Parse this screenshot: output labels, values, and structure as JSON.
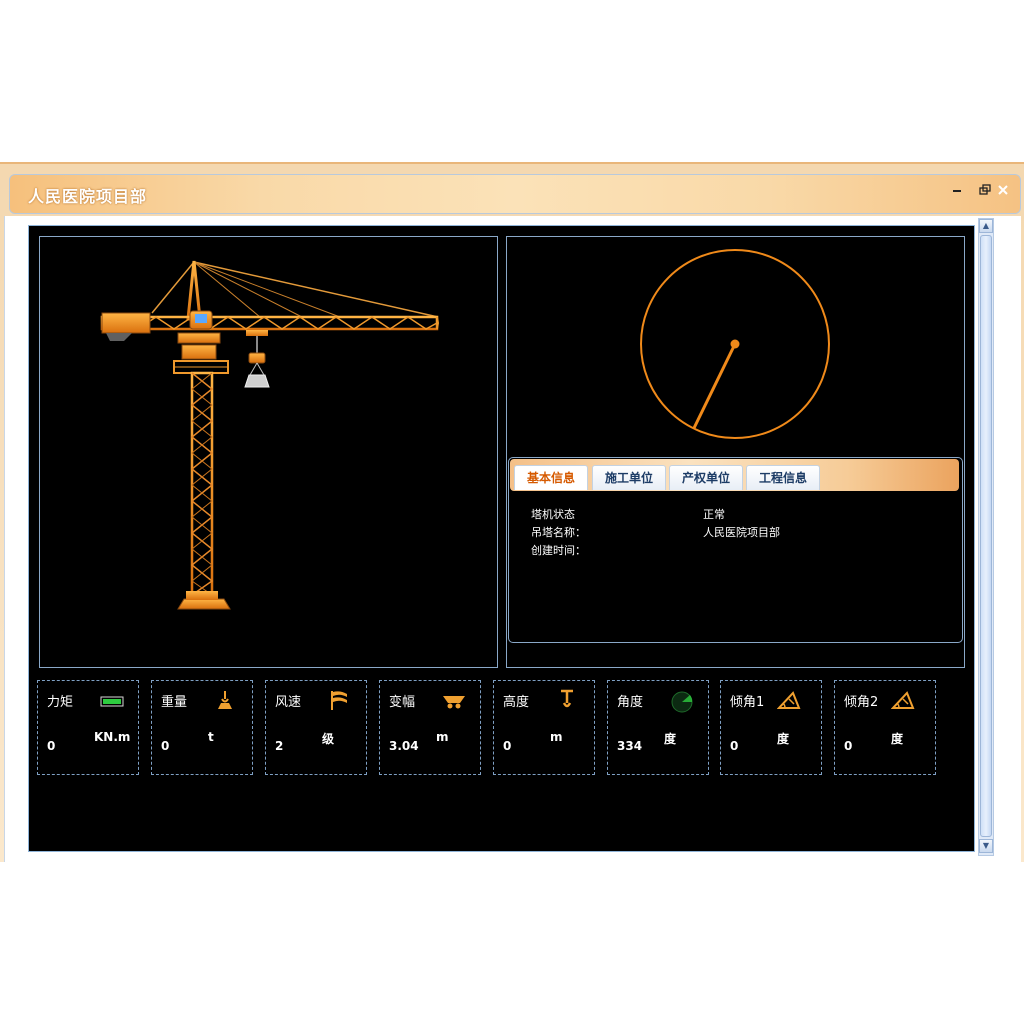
{
  "window": {
    "title": "人民医院项目部"
  },
  "tabs": [
    "基本信息",
    "施工单位",
    "产权单位",
    "工程信息"
  ],
  "info": [
    {
      "label": "塔机状态",
      "value": "正常"
    },
    {
      "label": "吊塔名称：",
      "value": "人民医院项目部"
    },
    {
      "label": "创建时间：",
      "value": ""
    }
  ],
  "metrics": [
    {
      "label": "力矩",
      "value": "0",
      "unit": "KN.m",
      "icon": "moment-gauge-icon"
    },
    {
      "label": "重量",
      "value": "0",
      "unit": "t",
      "icon": "hook-weight-icon"
    },
    {
      "label": "风速",
      "value": "2",
      "unit": "级",
      "icon": "wind-flag-icon"
    },
    {
      "label": "变幅",
      "value": "3.04",
      "unit": "m",
      "icon": "trolley-icon"
    },
    {
      "label": "高度",
      "value": "0",
      "unit": "m",
      "icon": "hook-height-icon"
    },
    {
      "label": "角度",
      "value": "334",
      "unit": "度",
      "icon": "radar-icon"
    },
    {
      "label": "倾角1",
      "value": "0",
      "unit": "度",
      "icon": "tilt-icon"
    },
    {
      "label": "倾角2",
      "value": "0",
      "unit": "度",
      "icon": "tilt-icon"
    }
  ],
  "radar": {
    "arm_angle_deg": 334
  },
  "colors": {
    "accent": "#f08a1a",
    "panel_border": "#8aa8c8",
    "tab_active": "#d65a00"
  }
}
